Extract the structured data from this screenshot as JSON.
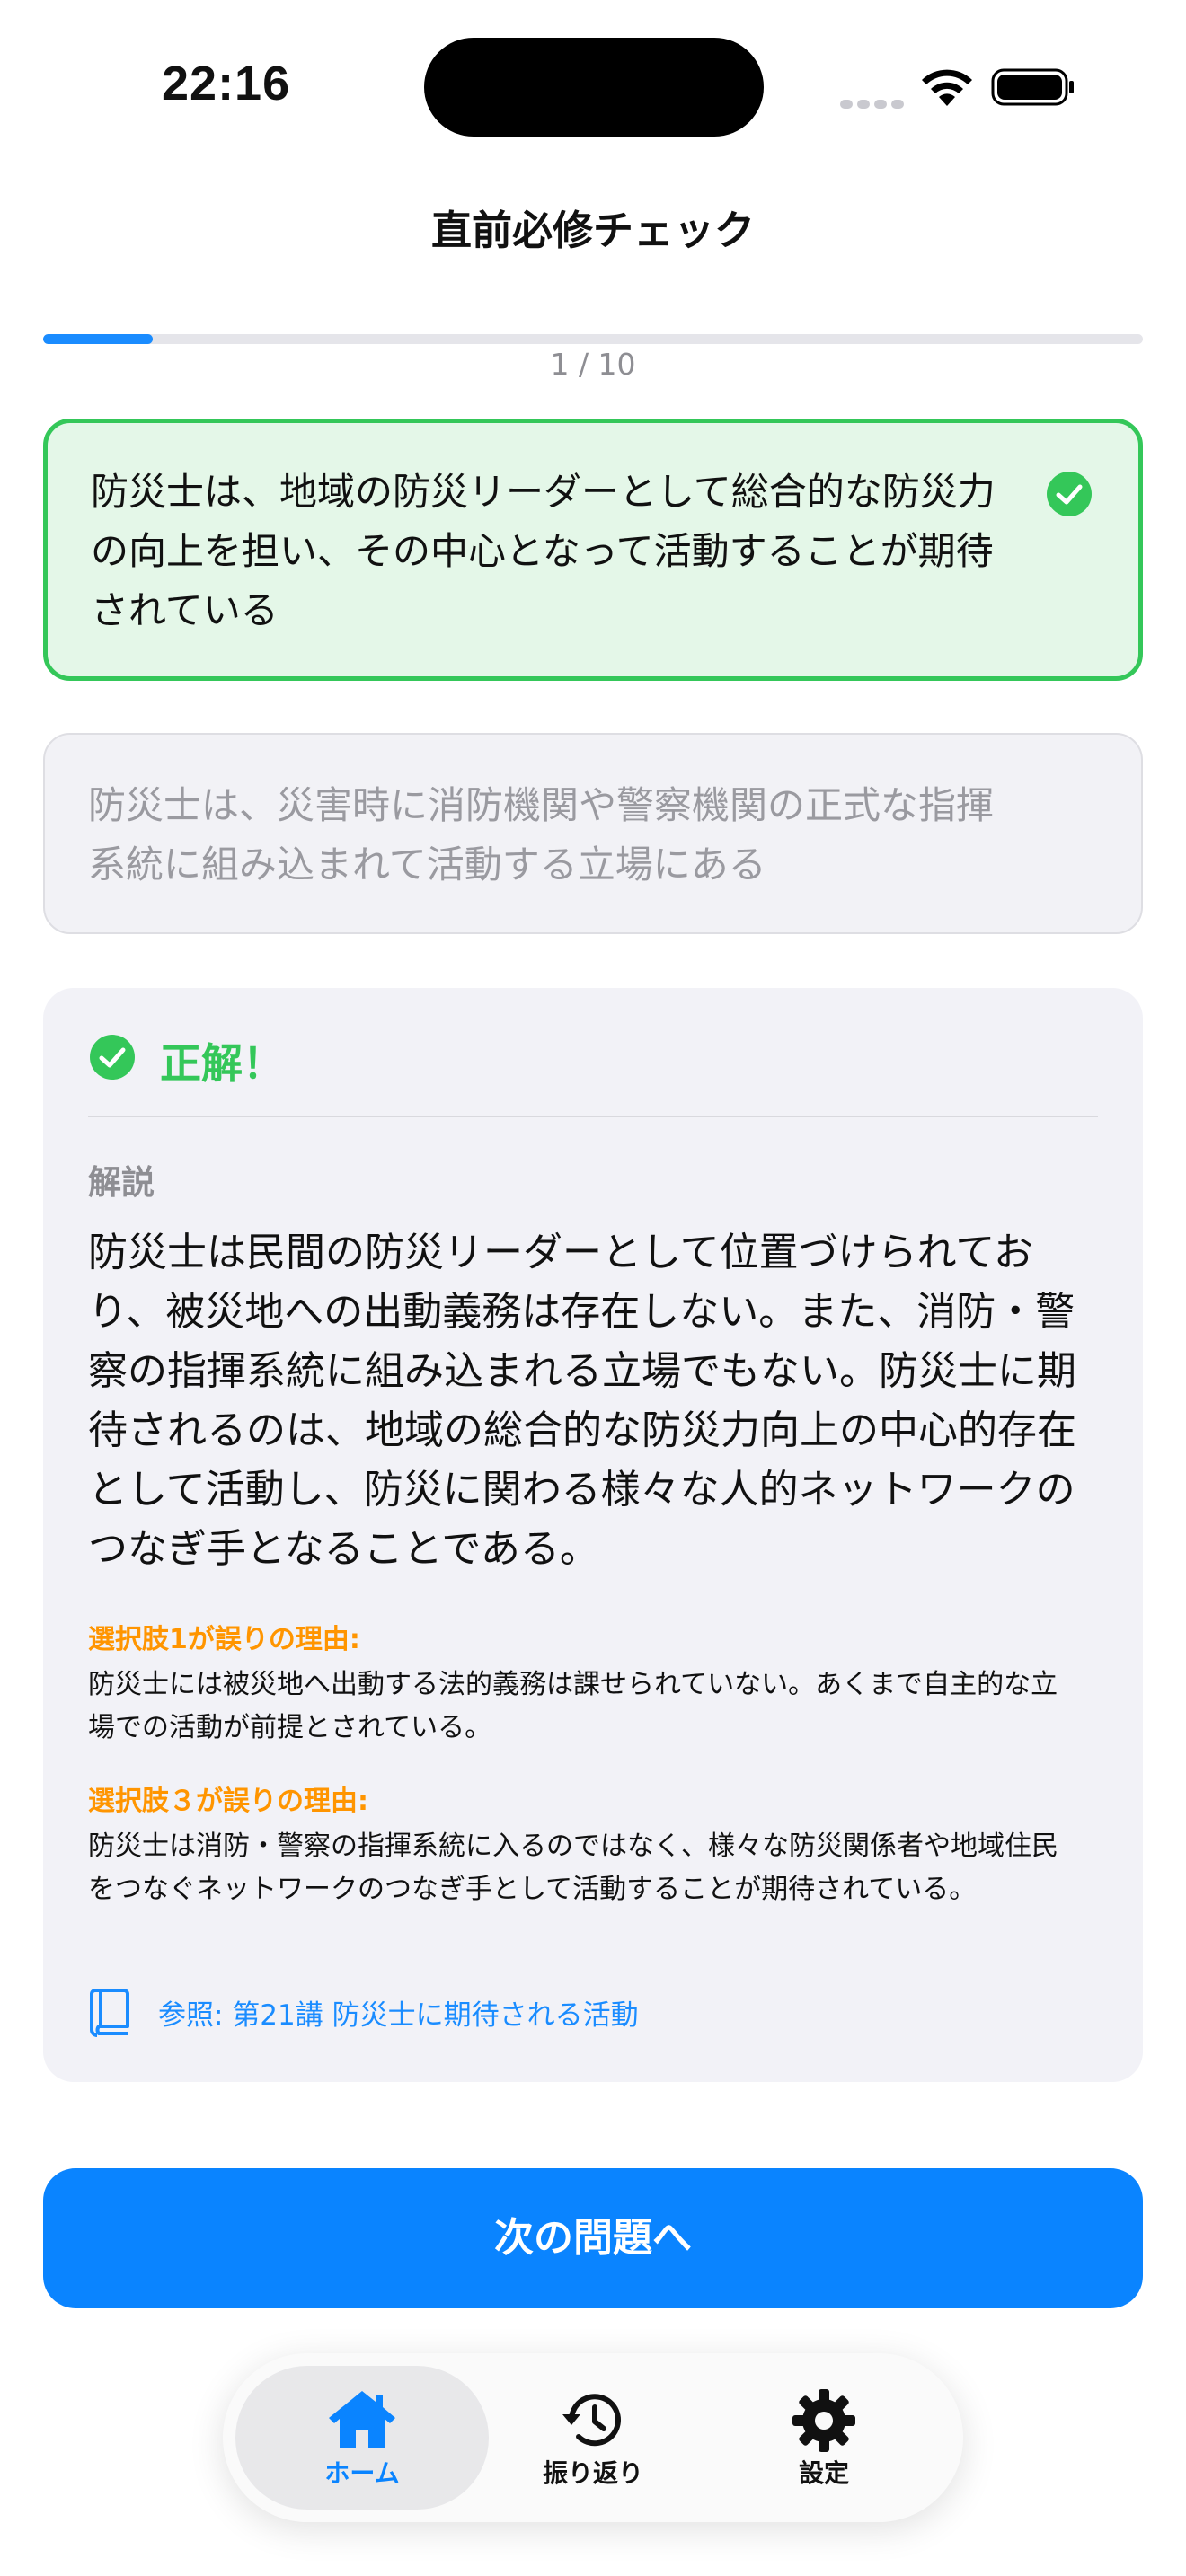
{
  "status_bar": {
    "time": "22:16"
  },
  "header": {
    "title": "直前必修チェック"
  },
  "progress": {
    "current": 1,
    "total": 10,
    "label": "1 / 10",
    "fraction": 0.1
  },
  "choices": [
    {
      "text": "防災士は、地域の防災リーダーとして総合的な防災力の向上を担い、その中心となって活動することが期待されている",
      "state": "correct-selected"
    },
    {
      "text": "防災士は、災害時に消防機関や警察機関の正式な指揮系統に組み込まれて活動する立場にある",
      "state": "dimmed"
    }
  ],
  "result": {
    "label": "正解！"
  },
  "explanation": {
    "section_label": "解説",
    "body": "防災士は民間の防災リーダーとして位置づけられており、被災地への出動義務は存在しない。また、消防・警察の指揮系統に組み込まれる立場でもない。防災士に期待されるのは、地域の総合的な防災力向上の中心的存在として活動し、防災に関わる様々な人的ネットワークのつなぎ手となることである。",
    "reasons": [
      {
        "title": "選択肢1が誤りの理由:",
        "text": "防災士には被災地へ出動する法的義務は課せられていない。あくまで自主的な立場での活動が前提とされている。"
      },
      {
        "title": "選択肢３が誤りの理由:",
        "text": "防災士は消防・警察の指揮系統に入るのではなく、様々な防災関係者や地域住民をつなぐネットワークのつなぎ手として活動することが期待されている。"
      }
    ],
    "reference": "参照: 第21講 防災士に期待される活動"
  },
  "next_button": {
    "label": "次の問題へ"
  },
  "tab_bar": {
    "tabs": [
      {
        "label": "ホーム",
        "icon": "house-icon",
        "active": true
      },
      {
        "label": "振り返り",
        "icon": "history-icon",
        "active": false
      },
      {
        "label": "設定",
        "icon": "gear-icon",
        "active": false
      }
    ]
  },
  "colors": {
    "accent": "#0a84ff",
    "correct": "#34c759",
    "warning": "#ff9500",
    "muted": "#8e8e93"
  }
}
